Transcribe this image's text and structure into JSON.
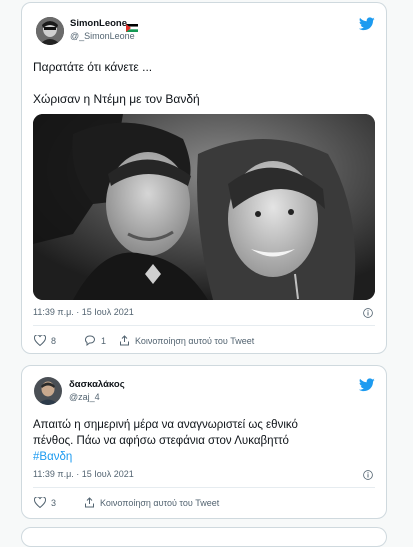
{
  "tweets": [
    {
      "author_name": "SimonLeone",
      "author_handle": "@_SimonLeone",
      "text_line1": "Παρατάτε ότι κάνετε ...",
      "text_line2": "Χώρισαν η Ντέμη με τον Βανδή",
      "time": "11:39 π.μ. · 15 Ιουλ 2021",
      "likes": "8",
      "replies": "1",
      "share_label": "Κοινοποίηση αυτού του Tweet"
    },
    {
      "author_name": "δασκαλάκος",
      "author_handle": "@zaj_4",
      "text_line1": "Απαιτώ η σημερινή μέρα να αναγνωριστεί ως εθνικό",
      "text_line2": "πένθος. Πάω να αφήσω στεφάνια στον Λυκαβηττό",
      "hashtag": "#Βανδη",
      "time": "11:39 π.μ. · 15 Ιουλ 2021",
      "likes": "3",
      "share_label": "Κοινοποίηση αυτού του Tweet"
    }
  ],
  "colors": {
    "accent": "#1d9bf0",
    "secondary_text": "#536471",
    "border": "#cfd9de"
  },
  "icons": [
    "twitter-bird-icon",
    "heart-icon",
    "reply-icon",
    "share-icon",
    "info-icon",
    "flag-icon"
  ]
}
